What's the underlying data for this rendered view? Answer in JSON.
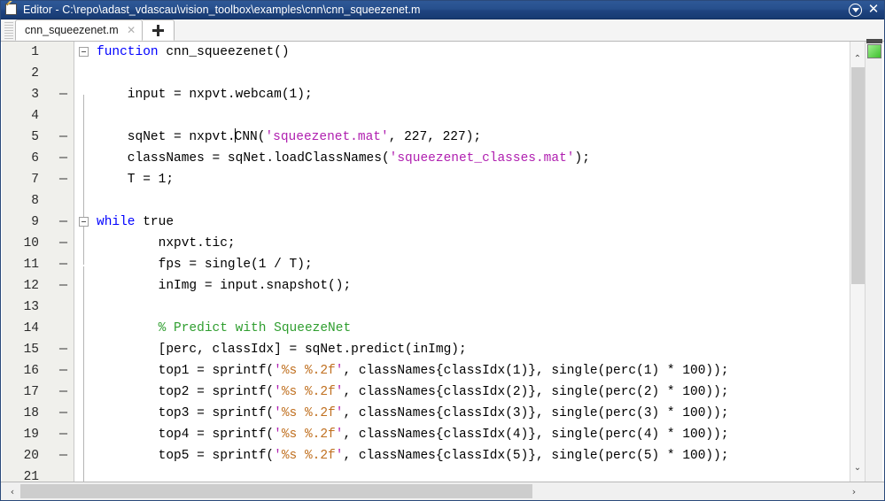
{
  "window": {
    "title": "Editor - C:\\repo\\adast_vdascau\\vision_toolbox\\examples\\cnn\\cnn_squeezenet.m",
    "icon": "editor-pencil-icon",
    "dock_menu_icon": "circled-chevron-down-icon",
    "close_icon": "✕"
  },
  "tabs": {
    "items": [
      {
        "label": "cnn_squeezenet.m",
        "close_icon": "✕",
        "active": true
      }
    ],
    "new_tab_icon": "plus-icon"
  },
  "editor": {
    "line_numbers": [
      "1",
      "2",
      "3",
      "4",
      "5",
      "6",
      "7",
      "8",
      "9",
      "10",
      "11",
      "12",
      "13",
      "14",
      "15",
      "16",
      "17",
      "18",
      "19",
      "20",
      "21"
    ],
    "breakpoint_marks": [
      "",
      "",
      "—",
      "",
      "—",
      "—",
      "—",
      "",
      "—",
      "—",
      "—",
      "—",
      "",
      "",
      "—",
      "—",
      "—",
      "—",
      "—",
      "—",
      ""
    ],
    "lines": [
      "function cnn_squeezenet()",
      "",
      "    input = nxpvt.webcam(1);",
      "",
      "    sqNet = nxpvt.CNN('squeezenet.mat', 227, 227);",
      "    classNames = sqNet.loadClassNames('squeezenet_classes.mat');",
      "    T = 1;",
      "",
      "while true",
      "        nxpvt.tic;",
      "        fps = single(1 / T);",
      "        inImg = input.snapshot();",
      "",
      "        % Predict with SqueezeNet",
      "        [perc, classIdx] = sqNet.predict(inImg);",
      "        top1 = sprintf('%s %.2f', classNames{classIdx(1)}, single(perc(1) * 100));",
      "        top2 = sprintf('%s %.2f', classNames{classIdx(2)}, single(perc(2) * 100));",
      "        top3 = sprintf('%s %.2f', classNames{classIdx(3)}, single(perc(3) * 100));",
      "        top4 = sprintf('%s %.2f', classNames{classIdx(4)}, single(perc(4) * 100));",
      "        top5 = sprintf('%s %.2f', classNames{classIdx(5)}, single(perc(5) * 100));",
      ""
    ],
    "cursor": {
      "line": 5,
      "after_text": "    sqNet = nxpvt."
    },
    "fold_markers": [
      {
        "line": 1,
        "state": "expanded"
      },
      {
        "line": 9,
        "state": "expanded"
      }
    ],
    "syntax_colors": {
      "keyword": "#0000ff",
      "string": "#b020b0",
      "format_spec": "#c07020",
      "comment": "#2f9e2f",
      "text": "#000000"
    }
  },
  "scrollbars": {
    "vertical": {
      "up_arrow": "⌃",
      "down_arrow": "⌄"
    },
    "horizontal": {
      "left_arrow": "‹",
      "right_arrow": "›"
    }
  },
  "analyzer": {
    "status_color": "#3fbf2f",
    "status_name": "code-analyzer-ok"
  }
}
